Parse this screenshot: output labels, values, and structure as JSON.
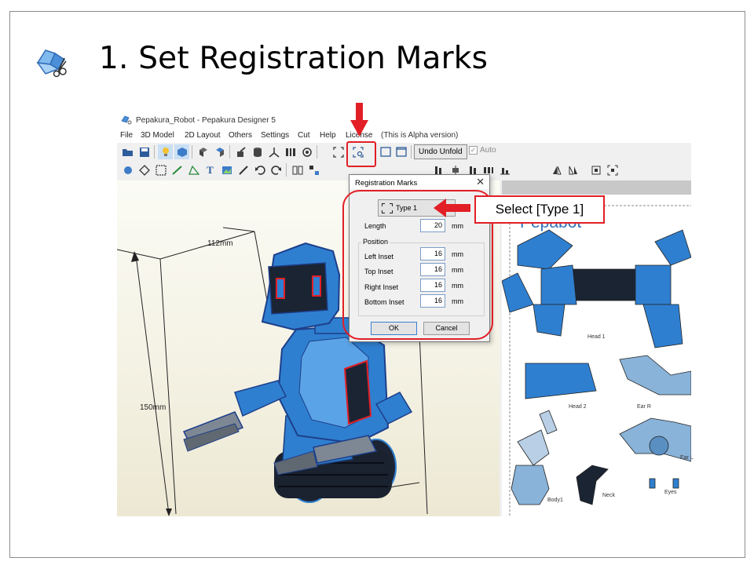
{
  "slide": {
    "title": "1. Set Registration Marks"
  },
  "app": {
    "window_title": "Pepakura_Robot - Pepakura Designer 5",
    "menu": [
      "File",
      "3D Model",
      "2D Layout",
      "Others",
      "Settings",
      "Cut",
      "Help",
      "License"
    ],
    "alpha_note": "(This is Alpha version)",
    "undo_unfold_label": "Undo Unfold",
    "auto_label": "Auto"
  },
  "view3d": {
    "width_label": "112mm",
    "height_label": "150mm"
  },
  "view2d": {
    "title": "Pepabot",
    "parts": [
      "Head 1",
      "Head 2",
      "Ear R",
      "Ear L",
      "Body1",
      "Neck",
      "Eyes"
    ]
  },
  "dialog": {
    "title": "Registration Marks",
    "close_glyph": "✕",
    "type_button_label": "Type 1",
    "length_label": "Length",
    "length_value": "20",
    "unit": "mm",
    "position_group_label": "Position",
    "fields": [
      {
        "label": "Left Inset",
        "value": "16"
      },
      {
        "label": "Top Inset",
        "value": "16"
      },
      {
        "label": "Right Inset",
        "value": "16"
      },
      {
        "label": "Bottom Inset",
        "value": "16"
      }
    ],
    "ok_label": "OK",
    "cancel_label": "Cancel"
  },
  "annotation": {
    "callout_text": "Select [Type 1]",
    "accent_color": "#e21f26"
  },
  "colors": {
    "robot_blue": "#2f7fd0",
    "robot_dark": "#1b2433",
    "pepa_blue": "#3070b8"
  },
  "icons": {
    "logo": "pepakura-logo-icon",
    "toolbar": [
      "open-icon",
      "save-icon",
      "light-icon",
      "texture-icon",
      "rotate-icon",
      "flip-icon",
      "brush-icon",
      "cylinder-icon",
      "axis-icon",
      "edge-icon",
      "view-icon",
      "registration-marks-icon",
      "window-icon"
    ]
  }
}
